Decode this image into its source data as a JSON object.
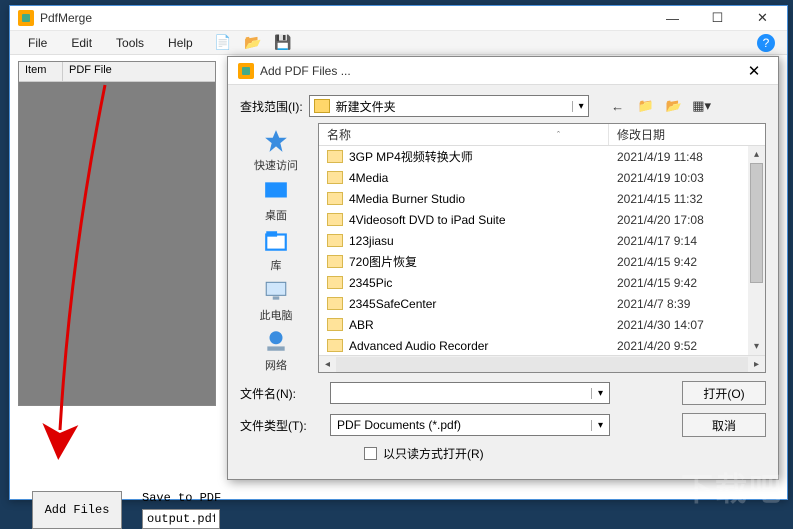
{
  "main": {
    "title": "PdfMerge",
    "menu": {
      "file": "File",
      "edit": "Edit",
      "tools": "Tools",
      "help": "Help"
    },
    "list_headers": {
      "item": "Item",
      "pdf": "PDF File"
    },
    "add_files_btn": "Add Files",
    "save_to_pdf_label": "Save to PDF",
    "output_value": "output.pdf"
  },
  "dialog": {
    "title": "Add PDF Files ...",
    "lookin_label": "查找范围(I):",
    "lookin_value": "新建文件夹",
    "places": {
      "quick": "快速访问",
      "desktop": "桌面",
      "library": "库",
      "thispc": "此电脑",
      "network": "网络"
    },
    "columns": {
      "name": "名称",
      "date": "修改日期"
    },
    "rows": [
      {
        "name": "3GP MP4视频转换大师",
        "date": "2021/4/19 11:48"
      },
      {
        "name": "4Media",
        "date": "2021/4/19 10:03"
      },
      {
        "name": "4Media Burner Studio",
        "date": "2021/4/15 11:32"
      },
      {
        "name": "4Videosoft DVD to iPad Suite",
        "date": "2021/4/20 17:08"
      },
      {
        "name": "123jiasu",
        "date": "2021/4/17 9:14"
      },
      {
        "name": "720图片恢复",
        "date": "2021/4/15 9:42"
      },
      {
        "name": "2345Pic",
        "date": "2021/4/15 9:42"
      },
      {
        "name": "2345SafeCenter",
        "date": "2021/4/7 8:39"
      },
      {
        "name": "ABR",
        "date": "2021/4/30 14:07"
      },
      {
        "name": "Advanced Audio Recorder",
        "date": "2021/4/20 9:52"
      }
    ],
    "filename_label": "文件名(N):",
    "filename_value": "",
    "filetype_label": "文件类型(T):",
    "filetype_value": "PDF Documents (*.pdf)",
    "readonly_label": "以只读方式打开(R)",
    "open_btn": "打开(O)",
    "cancel_btn": "取消"
  },
  "watermark": "下载吧"
}
